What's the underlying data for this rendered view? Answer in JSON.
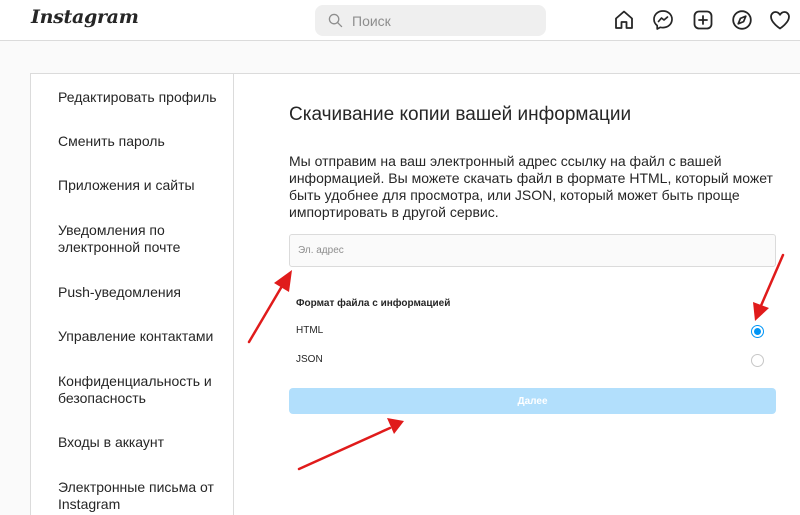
{
  "header": {
    "logo": "Instagram",
    "search": {
      "placeholder": "Поиск",
      "icon": "search-icon"
    },
    "nav_icons": [
      "home-icon",
      "messenger-icon",
      "new-post-icon",
      "explore-icon",
      "activity-heart-icon"
    ]
  },
  "sidebar": {
    "items": [
      {
        "label": "Редактировать профиль"
      },
      {
        "label": "Сменить пароль"
      },
      {
        "label": "Приложения и сайты"
      },
      {
        "label": "Уведомления по электронной почте"
      },
      {
        "label": "Push-уведомления"
      },
      {
        "label": "Управление контактами"
      },
      {
        "label": "Конфиденциальность и безопасность"
      },
      {
        "label": "Входы в аккаунт"
      },
      {
        "label": "Электронные письма от Instagram"
      }
    ]
  },
  "main": {
    "title": "Скачивание копии вашей информации",
    "description": "Мы отправим на ваш электронный адрес ссылку на файл с вашей информацией. Вы можете скачать файл в формате HTML, который может быть удобнее для просмотра, или JSON, который может быть проще импортировать в другой сервис.",
    "email": {
      "value": "",
      "placeholder": "Эл. адрес"
    },
    "format_label": "Формат файла с информацией",
    "formats": [
      {
        "label": "HTML",
        "selected": true
      },
      {
        "label": "JSON",
        "selected": false
      }
    ],
    "next_label": "Далее"
  },
  "colors": {
    "accent": "#0095f6",
    "button_disabled": "#b2dffc",
    "annotation_arrow": "#e01b1b",
    "border": "#dbdbdb"
  },
  "annotations": [
    "red-arrow-to-email-field",
    "red-arrow-to-html-radio",
    "red-arrow-to-next-button"
  ]
}
